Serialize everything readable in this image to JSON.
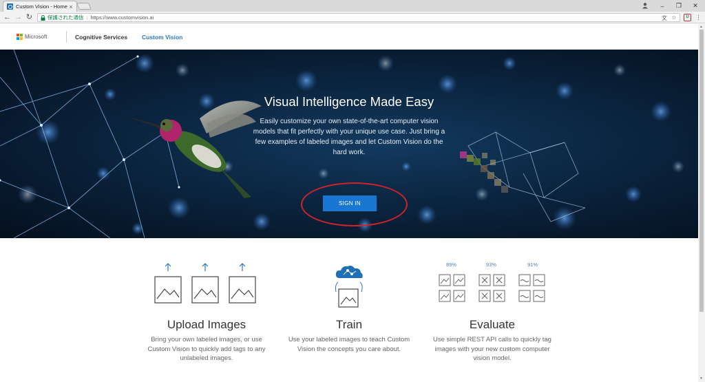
{
  "browser": {
    "tab_title": "Custom Vision - Home",
    "tab_close": "×",
    "secure_label": "保護された通信",
    "url": "https://www.customvision.ai",
    "window_controls": [
      "–",
      "❐",
      "✕"
    ]
  },
  "header": {
    "brand": "Microsoft",
    "nav_cognitive": "Cognitive Services",
    "nav_custom_vision": "Custom Vision",
    "colors": {
      "ms_red": "#f25022",
      "ms_green": "#7fba00",
      "ms_blue": "#00a4ef",
      "ms_yellow": "#ffb900",
      "link": "#2678c0"
    }
  },
  "hero": {
    "title": "Visual Intelligence Made Easy",
    "description": "Easily customize your own state-of-the-art computer vision models that fit perfectly with your unique use case. Just bring a few examples of labeled images and let Custom Vision do the hard work.",
    "sign_in_label": "SIGN IN",
    "colors": {
      "button": "#1976d2",
      "highlight_ellipse": "#d2232a"
    }
  },
  "features": [
    {
      "title": "Upload Images",
      "description": "Bring your own labeled images, or use Custom Vision to quickly add tags to any unlabeled images.",
      "icon": "upload-images-icon"
    },
    {
      "title": "Train",
      "description": "Use your labeled images to teach Custom Vision the concepts you care about.",
      "icon": "train-cloud-brain-icon"
    },
    {
      "title": "Evaluate",
      "description": "Use simple REST API calls to quickly tag images with your new custom computer vision model.",
      "icon": "evaluate-grid-icon",
      "percentages": [
        "89%",
        "93%",
        "91%"
      ]
    }
  ]
}
